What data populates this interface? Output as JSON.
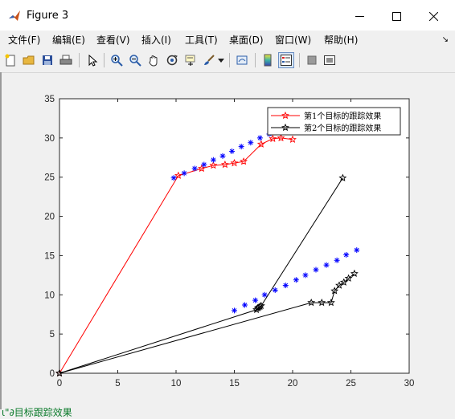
{
  "window": {
    "title": "Figure 3"
  },
  "menu": [
    "文件(F)",
    "编辑(E)",
    "查看(V)",
    "插入(I)",
    "工具(T)",
    "桌面(D)",
    "窗口(W)",
    "帮助(H)"
  ],
  "toolbar": {
    "icons": [
      "new-figure-icon",
      "open-icon",
      "save-icon",
      "print-icon",
      "pointer-icon",
      "zoom-in-icon",
      "zoom-out-icon",
      "pan-icon",
      "rotate-icon",
      "data-cursor-icon",
      "brush-icon",
      "brush-dropdown-icon",
      "link-plot-icon",
      "colorbar-icon",
      "legend-icon",
      "hide-plot-tools-icon",
      "show-plot-tools-icon"
    ]
  },
  "status_text": "ι\"∂目标跟踪效果",
  "chart_data": {
    "type": "line",
    "xlim": [
      0,
      30
    ],
    "ylim": [
      0,
      35
    ],
    "xticks": [
      0,
      5,
      10,
      15,
      20,
      25,
      30
    ],
    "yticks": [
      0,
      5,
      10,
      15,
      20,
      25,
      30,
      35
    ],
    "legend_position": "top-right",
    "legend": [
      "第1个目标的跟踪效果",
      "第2个目标的跟踪效果"
    ],
    "colors": {
      "target1": "#ff0000",
      "target2": "#000000",
      "truth": "#0000ff"
    },
    "series": [
      {
        "name": "第1个目标的跟踪效果",
        "marker": "star",
        "color": "#ff0000",
        "x": [
          0,
          10.2,
          12.2,
          13.2,
          14.2,
          15.0,
          15.8,
          17.3,
          18.3,
          19.0,
          20.0
        ],
        "y": [
          0,
          25.2,
          26.1,
          26.5,
          26.6,
          26.8,
          27.0,
          29.2,
          29.9,
          30.0,
          29.8
        ]
      },
      {
        "name": "第2个目标的跟踪效果",
        "marker": "star",
        "color": "#000000",
        "x": [
          0,
          21.6,
          22.5,
          23.3,
          23.6,
          24.0,
          24.4,
          24.8,
          25.3
        ],
        "y": [
          0,
          9.0,
          9.0,
          9.0,
          10.5,
          11.2,
          11.6,
          12.1,
          12.7
        ]
      },
      {
        "name": "",
        "marker": "star",
        "color": "#000000",
        "x": [
          0,
          16.9,
          17.0,
          17.1,
          17.2,
          17.3,
          24.3
        ],
        "y": [
          0,
          8.1,
          8.3,
          8.4,
          8.5,
          8.6,
          24.9
        ]
      },
      {
        "name": "",
        "marker": "asterisk",
        "color": "#0000ff",
        "line": false,
        "x": [
          9.8,
          10.7,
          11.6,
          12.4,
          13.2,
          14.0,
          14.8,
          15.6,
          16.4,
          17.2,
          18.0
        ],
        "y": [
          24.9,
          25.5,
          26.1,
          26.6,
          27.2,
          27.7,
          28.3,
          28.9,
          29.4,
          30.0,
          30.5
        ]
      },
      {
        "name": "",
        "marker": "asterisk",
        "color": "#0000ff",
        "line": false,
        "x": [
          15.0,
          15.9,
          16.8,
          17.6,
          18.5,
          19.4,
          20.3,
          21.1,
          22.0,
          22.9,
          23.8,
          24.6,
          25.5
        ],
        "y": [
          8.0,
          8.7,
          9.3,
          10.0,
          10.6,
          11.2,
          11.9,
          12.5,
          13.2,
          13.8,
          14.4,
          15.1,
          15.7
        ]
      }
    ]
  }
}
